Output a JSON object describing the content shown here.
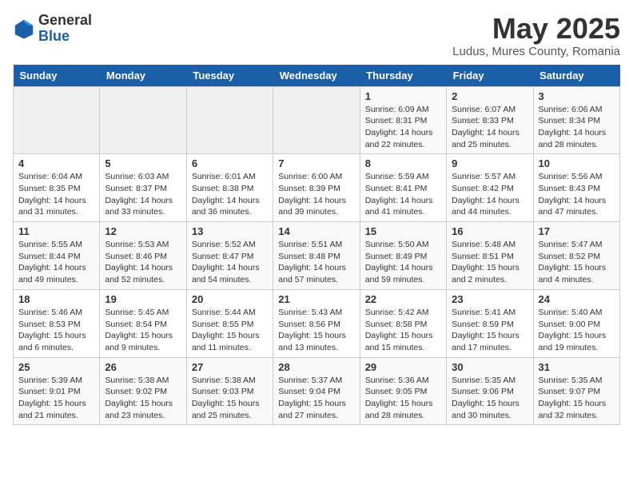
{
  "header": {
    "logo_line1": "General",
    "logo_line2": "Blue",
    "month_title": "May 2025",
    "subtitle": "Ludus, Mures County, Romania"
  },
  "weekdays": [
    "Sunday",
    "Monday",
    "Tuesday",
    "Wednesday",
    "Thursday",
    "Friday",
    "Saturday"
  ],
  "weeks": [
    [
      {
        "num": "",
        "info": ""
      },
      {
        "num": "",
        "info": ""
      },
      {
        "num": "",
        "info": ""
      },
      {
        "num": "",
        "info": ""
      },
      {
        "num": "1",
        "info": "Sunrise: 6:09 AM\nSunset: 8:31 PM\nDaylight: 14 hours\nand 22 minutes."
      },
      {
        "num": "2",
        "info": "Sunrise: 6:07 AM\nSunset: 8:33 PM\nDaylight: 14 hours\nand 25 minutes."
      },
      {
        "num": "3",
        "info": "Sunrise: 6:06 AM\nSunset: 8:34 PM\nDaylight: 14 hours\nand 28 minutes."
      }
    ],
    [
      {
        "num": "4",
        "info": "Sunrise: 6:04 AM\nSunset: 8:35 PM\nDaylight: 14 hours\nand 31 minutes."
      },
      {
        "num": "5",
        "info": "Sunrise: 6:03 AM\nSunset: 8:37 PM\nDaylight: 14 hours\nand 33 minutes."
      },
      {
        "num": "6",
        "info": "Sunrise: 6:01 AM\nSunset: 8:38 PM\nDaylight: 14 hours\nand 36 minutes."
      },
      {
        "num": "7",
        "info": "Sunrise: 6:00 AM\nSunset: 8:39 PM\nDaylight: 14 hours\nand 39 minutes."
      },
      {
        "num": "8",
        "info": "Sunrise: 5:59 AM\nSunset: 8:41 PM\nDaylight: 14 hours\nand 41 minutes."
      },
      {
        "num": "9",
        "info": "Sunrise: 5:57 AM\nSunset: 8:42 PM\nDaylight: 14 hours\nand 44 minutes."
      },
      {
        "num": "10",
        "info": "Sunrise: 5:56 AM\nSunset: 8:43 PM\nDaylight: 14 hours\nand 47 minutes."
      }
    ],
    [
      {
        "num": "11",
        "info": "Sunrise: 5:55 AM\nSunset: 8:44 PM\nDaylight: 14 hours\nand 49 minutes."
      },
      {
        "num": "12",
        "info": "Sunrise: 5:53 AM\nSunset: 8:46 PM\nDaylight: 14 hours\nand 52 minutes."
      },
      {
        "num": "13",
        "info": "Sunrise: 5:52 AM\nSunset: 8:47 PM\nDaylight: 14 hours\nand 54 minutes."
      },
      {
        "num": "14",
        "info": "Sunrise: 5:51 AM\nSunset: 8:48 PM\nDaylight: 14 hours\nand 57 minutes."
      },
      {
        "num": "15",
        "info": "Sunrise: 5:50 AM\nSunset: 8:49 PM\nDaylight: 14 hours\nand 59 minutes."
      },
      {
        "num": "16",
        "info": "Sunrise: 5:48 AM\nSunset: 8:51 PM\nDaylight: 15 hours\nand 2 minutes."
      },
      {
        "num": "17",
        "info": "Sunrise: 5:47 AM\nSunset: 8:52 PM\nDaylight: 15 hours\nand 4 minutes."
      }
    ],
    [
      {
        "num": "18",
        "info": "Sunrise: 5:46 AM\nSunset: 8:53 PM\nDaylight: 15 hours\nand 6 minutes."
      },
      {
        "num": "19",
        "info": "Sunrise: 5:45 AM\nSunset: 8:54 PM\nDaylight: 15 hours\nand 9 minutes."
      },
      {
        "num": "20",
        "info": "Sunrise: 5:44 AM\nSunset: 8:55 PM\nDaylight: 15 hours\nand 11 minutes."
      },
      {
        "num": "21",
        "info": "Sunrise: 5:43 AM\nSunset: 8:56 PM\nDaylight: 15 hours\nand 13 minutes."
      },
      {
        "num": "22",
        "info": "Sunrise: 5:42 AM\nSunset: 8:58 PM\nDaylight: 15 hours\nand 15 minutes."
      },
      {
        "num": "23",
        "info": "Sunrise: 5:41 AM\nSunset: 8:59 PM\nDaylight: 15 hours\nand 17 minutes."
      },
      {
        "num": "24",
        "info": "Sunrise: 5:40 AM\nSunset: 9:00 PM\nDaylight: 15 hours\nand 19 minutes."
      }
    ],
    [
      {
        "num": "25",
        "info": "Sunrise: 5:39 AM\nSunset: 9:01 PM\nDaylight: 15 hours\nand 21 minutes."
      },
      {
        "num": "26",
        "info": "Sunrise: 5:38 AM\nSunset: 9:02 PM\nDaylight: 15 hours\nand 23 minutes."
      },
      {
        "num": "27",
        "info": "Sunrise: 5:38 AM\nSunset: 9:03 PM\nDaylight: 15 hours\nand 25 minutes."
      },
      {
        "num": "28",
        "info": "Sunrise: 5:37 AM\nSunset: 9:04 PM\nDaylight: 15 hours\nand 27 minutes."
      },
      {
        "num": "29",
        "info": "Sunrise: 5:36 AM\nSunset: 9:05 PM\nDaylight: 15 hours\nand 28 minutes."
      },
      {
        "num": "30",
        "info": "Sunrise: 5:35 AM\nSunset: 9:06 PM\nDaylight: 15 hours\nand 30 minutes."
      },
      {
        "num": "31",
        "info": "Sunrise: 5:35 AM\nSunset: 9:07 PM\nDaylight: 15 hours\nand 32 minutes."
      }
    ]
  ]
}
